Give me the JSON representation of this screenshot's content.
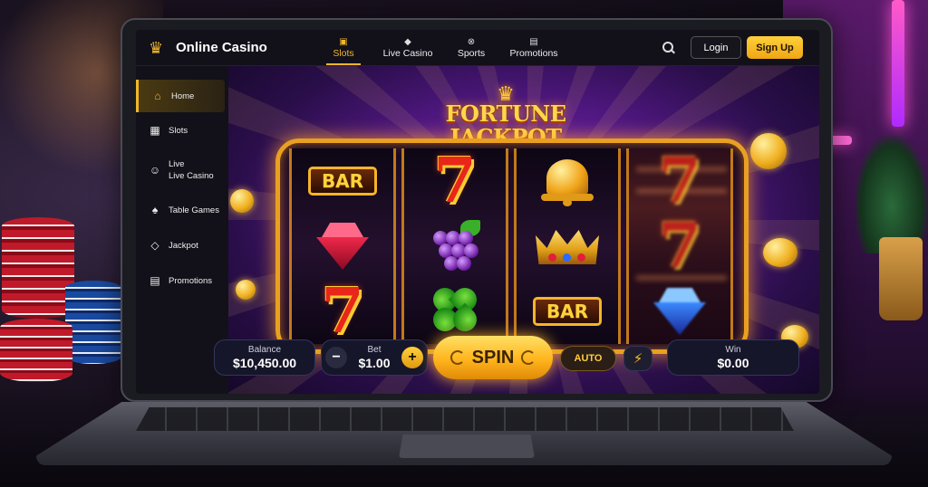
{
  "app": {
    "brand": "Online Casino"
  },
  "nav": [
    {
      "label": "Slots",
      "icon": "slots-icon",
      "active": true
    },
    {
      "label": "Live Casino",
      "icon": "live-casino-icon",
      "active": false
    },
    {
      "label": "Sports",
      "icon": "sports-icon",
      "active": false
    },
    {
      "label": "Promotions",
      "icon": "gift-icon",
      "active": false
    }
  ],
  "header": {
    "login_label": "Login",
    "signup_label": "Sign Up"
  },
  "sidebar": {
    "items": [
      {
        "label": "Home",
        "icon": "home-icon",
        "active": true
      },
      {
        "label": "Slots",
        "icon": "slots-icon"
      },
      {
        "label_top": "Live",
        "label": "Live Casino",
        "icon": "live-dealer-icon"
      },
      {
        "label": "Table Games",
        "icon": "cards-icon"
      },
      {
        "label": "Jackpot",
        "icon": "diamond-icon"
      },
      {
        "label": "Promotions",
        "icon": "gift-icon"
      }
    ]
  },
  "game": {
    "title": "FORTUNE JACKPOT",
    "symbols": {
      "bar": "BAR",
      "seven": "7"
    },
    "reels": [
      [
        "BAR",
        "diamond",
        "seven"
      ],
      [
        "seven",
        "grapes",
        "clover"
      ],
      [
        "bell",
        "crown",
        "BAR"
      ],
      [
        "seven",
        "seven",
        "diamond"
      ]
    ]
  },
  "controls": {
    "balance_label": "Balance",
    "balance_value": "$10,450.00",
    "bet_label": "Bet",
    "bet_value": "$1.00",
    "minus": "−",
    "plus": "+",
    "spin_label": "SPIN",
    "auto_label": "AUTO",
    "bolt": "⚡",
    "win_label": "Win",
    "win_value": "$0.00"
  },
  "colors": {
    "accent": "#f2b62c",
    "frame": "#e9a021",
    "panel": "#121119"
  }
}
